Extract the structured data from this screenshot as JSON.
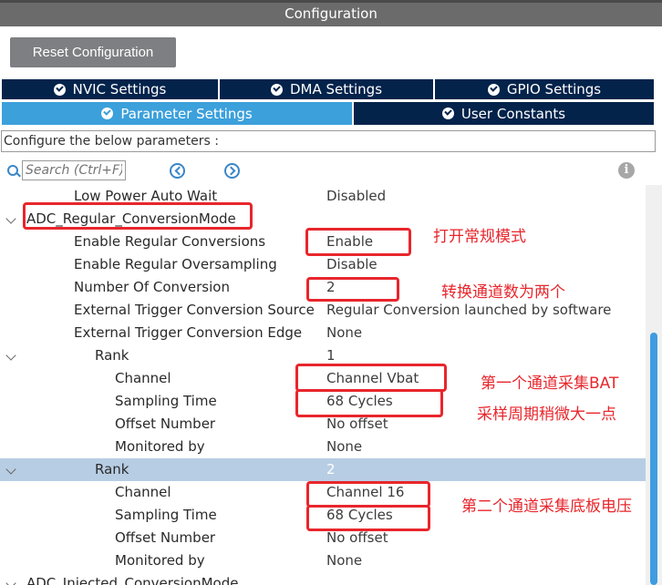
{
  "header": {
    "title": "Configuration"
  },
  "reset_button": "Reset Configuration",
  "tabs": [
    {
      "label": "NVIC Settings"
    },
    {
      "label": "DMA Settings"
    },
    {
      "label": "GPIO Settings"
    },
    {
      "label": "Parameter Settings"
    },
    {
      "label": "User Constants"
    }
  ],
  "configure_label": "Configure the below parameters :",
  "search": {
    "placeholder": "Search (Ctrl+F)",
    "value": ""
  },
  "info_icon_glyph": "i",
  "tree": [
    {
      "label": "Low Power Auto Wait",
      "value": "Disabled"
    },
    {
      "label": "ADC_Regular_ConversionMode",
      "value": ""
    },
    {
      "label": "Enable Regular Conversions",
      "value": "Enable"
    },
    {
      "label": "Enable Regular Oversampling",
      "value": "Disable"
    },
    {
      "label": "Number Of Conversion",
      "value": "2"
    },
    {
      "label": "External Trigger Conversion Source",
      "value": "Regular Conversion launched by software"
    },
    {
      "label": "External Trigger Conversion Edge",
      "value": "None"
    },
    {
      "label": "Rank",
      "value": "1"
    },
    {
      "label": "Channel",
      "value": "Channel Vbat"
    },
    {
      "label": "Sampling Time",
      "value": "68 Cycles"
    },
    {
      "label": "Offset Number",
      "value": "No offset"
    },
    {
      "label": "Monitored by",
      "value": "None"
    },
    {
      "label": "Rank",
      "value": "2"
    },
    {
      "label": "Channel",
      "value": "Channel 16"
    },
    {
      "label": "Sampling Time",
      "value": "68 Cycles"
    },
    {
      "label": "Offset Number",
      "value": "No offset"
    },
    {
      "label": "Monitored by",
      "value": "None"
    },
    {
      "label": "ADC_Injected_ConversionMode",
      "value": ""
    }
  ],
  "annotations": {
    "enable_regular": "打开常规模式",
    "conversion_count": "转换通道数为两个",
    "channel_bat": "第一个通道采集BAT",
    "sampling": "采样周期稍微大一点",
    "channel_16": "第二个通道采集底板电压"
  },
  "colors": {
    "tab_dark": "#03234b",
    "tab_active": "#3ca0db",
    "highlight_red": "#e8262c",
    "selected_row": "#b7cde3"
  }
}
